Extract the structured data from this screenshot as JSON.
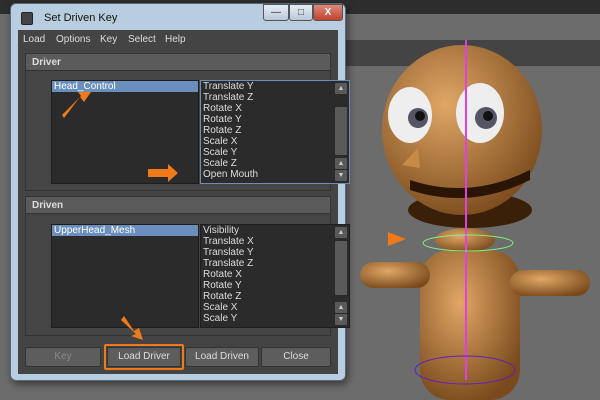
{
  "window": {
    "title": "Set Driven Key",
    "minimize": "—",
    "maximize": "□",
    "close": "X"
  },
  "menu": [
    "Load",
    "Options",
    "Key",
    "Select",
    "Help"
  ],
  "driver": {
    "header": "Driver",
    "object": "Head_Control",
    "attributes": [
      "Translate Y",
      "Translate Z",
      "Rotate X",
      "Rotate Y",
      "Rotate Z",
      "Scale X",
      "Scale Y",
      "Scale Z",
      "Open Mouth"
    ]
  },
  "driven": {
    "header": "Driven",
    "object": "UpperHead_Mesh",
    "attributes": [
      "Visibility",
      "Translate X",
      "Translate Y",
      "Translate Z",
      "Rotate X",
      "Rotate Y",
      "Rotate Z",
      "Scale X",
      "Scale Y"
    ]
  },
  "buttons": {
    "key": "Key",
    "load_driver": "Load Driver",
    "load_driven": "Load Driven",
    "close": "Close"
  },
  "colors": {
    "accent": "#f07a1a",
    "selection": "#6a8fbc"
  }
}
